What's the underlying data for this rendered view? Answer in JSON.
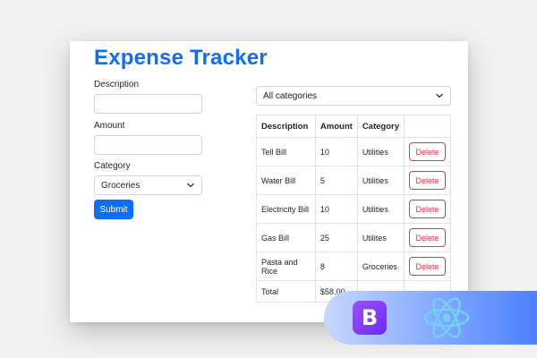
{
  "app": {
    "title": "Expense Tracker"
  },
  "form": {
    "description_label": "Description",
    "description_value": "",
    "amount_label": "Amount",
    "amount_value": "",
    "category_label": "Category",
    "category_selected": "Groceries",
    "submit_label": "Submit"
  },
  "filter": {
    "selected": "All categories"
  },
  "table": {
    "headers": [
      "Description",
      "Amount",
      "Category",
      ""
    ],
    "rows": [
      {
        "description": "Tell Bill",
        "amount": "10",
        "category": "Utilities",
        "action": "Delete"
      },
      {
        "description": "Water Bill",
        "amount": "5",
        "category": "Utilities",
        "action": "Delete"
      },
      {
        "description": "Electricity Bill",
        "amount": "10",
        "category": "Utilities",
        "action": "Delete"
      },
      {
        "description": "Gas Bill",
        "amount": "25",
        "category": "Utilites",
        "action": "Delete"
      },
      {
        "description": "Pasta and Rice",
        "amount": "8",
        "category": "Groceries",
        "action": "Delete"
      }
    ],
    "total_label": "Total",
    "total_value": "$58.00"
  },
  "badges": {
    "bootstrap_letter": "B",
    "bootstrap_icon": "bootstrap-logo-icon",
    "react_icon": "react-logo-icon"
  },
  "colors": {
    "primary": "#0d6efd",
    "danger": "#dc3545",
    "bootstrap_purple": "#7c3aed",
    "react_blue": "#58c4dc"
  }
}
